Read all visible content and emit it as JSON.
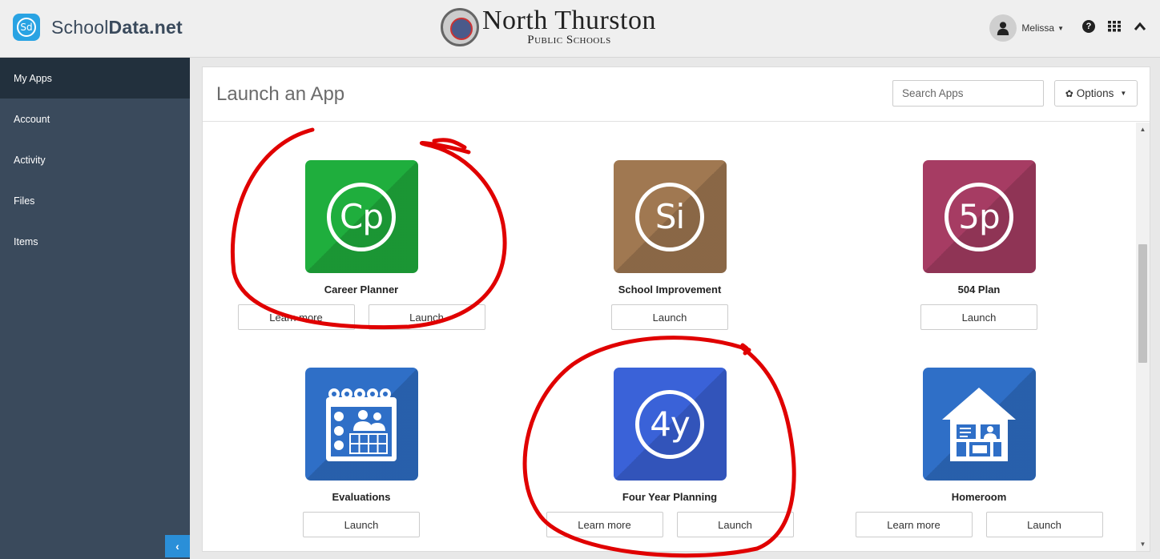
{
  "header": {
    "brand_prefix": "School",
    "brand_bold": "Data.net",
    "brand_logo": "Sd",
    "district_name": "North Thurston",
    "district_sub": "Public Schools",
    "user_name": "Melissa",
    "icons": [
      "user-icon",
      "help-icon",
      "apps-grid-icon",
      "chevron-up-icon"
    ]
  },
  "sidebar": {
    "items": [
      {
        "label": "My Apps",
        "active": true
      },
      {
        "label": "Account"
      },
      {
        "label": "Activity"
      },
      {
        "label": "Files"
      },
      {
        "label": "Items"
      }
    ]
  },
  "main": {
    "title": "Launch an App",
    "search_placeholder": "Search Apps",
    "options_label": "Options"
  },
  "apps": [
    {
      "name": "Career Planner",
      "glyph": "Cp",
      "color": "#1fae3d",
      "buttons": [
        "Learn more",
        "Launch"
      ]
    },
    {
      "name": "School Improvement",
      "glyph": "Si",
      "color": "#a07851",
      "buttons": [
        "Launch"
      ]
    },
    {
      "name": "504 Plan",
      "glyph": "5p",
      "color": "#a63c63",
      "buttons": [
        "Launch"
      ]
    },
    {
      "name": "Evaluations",
      "glyph": "calendar-checklist-icon",
      "color": "#2f6fc7",
      "buttons": [
        "Launch"
      ]
    },
    {
      "name": "Four Year Planning",
      "glyph": "4y",
      "color": "#3a62d8",
      "buttons": [
        "Learn more",
        "Launch"
      ]
    },
    {
      "name": "Homeroom",
      "glyph": "house-icon",
      "color": "#2f6fc7",
      "buttons": [
        "Learn more",
        "Launch"
      ]
    }
  ],
  "annotation_color": "#e00000"
}
